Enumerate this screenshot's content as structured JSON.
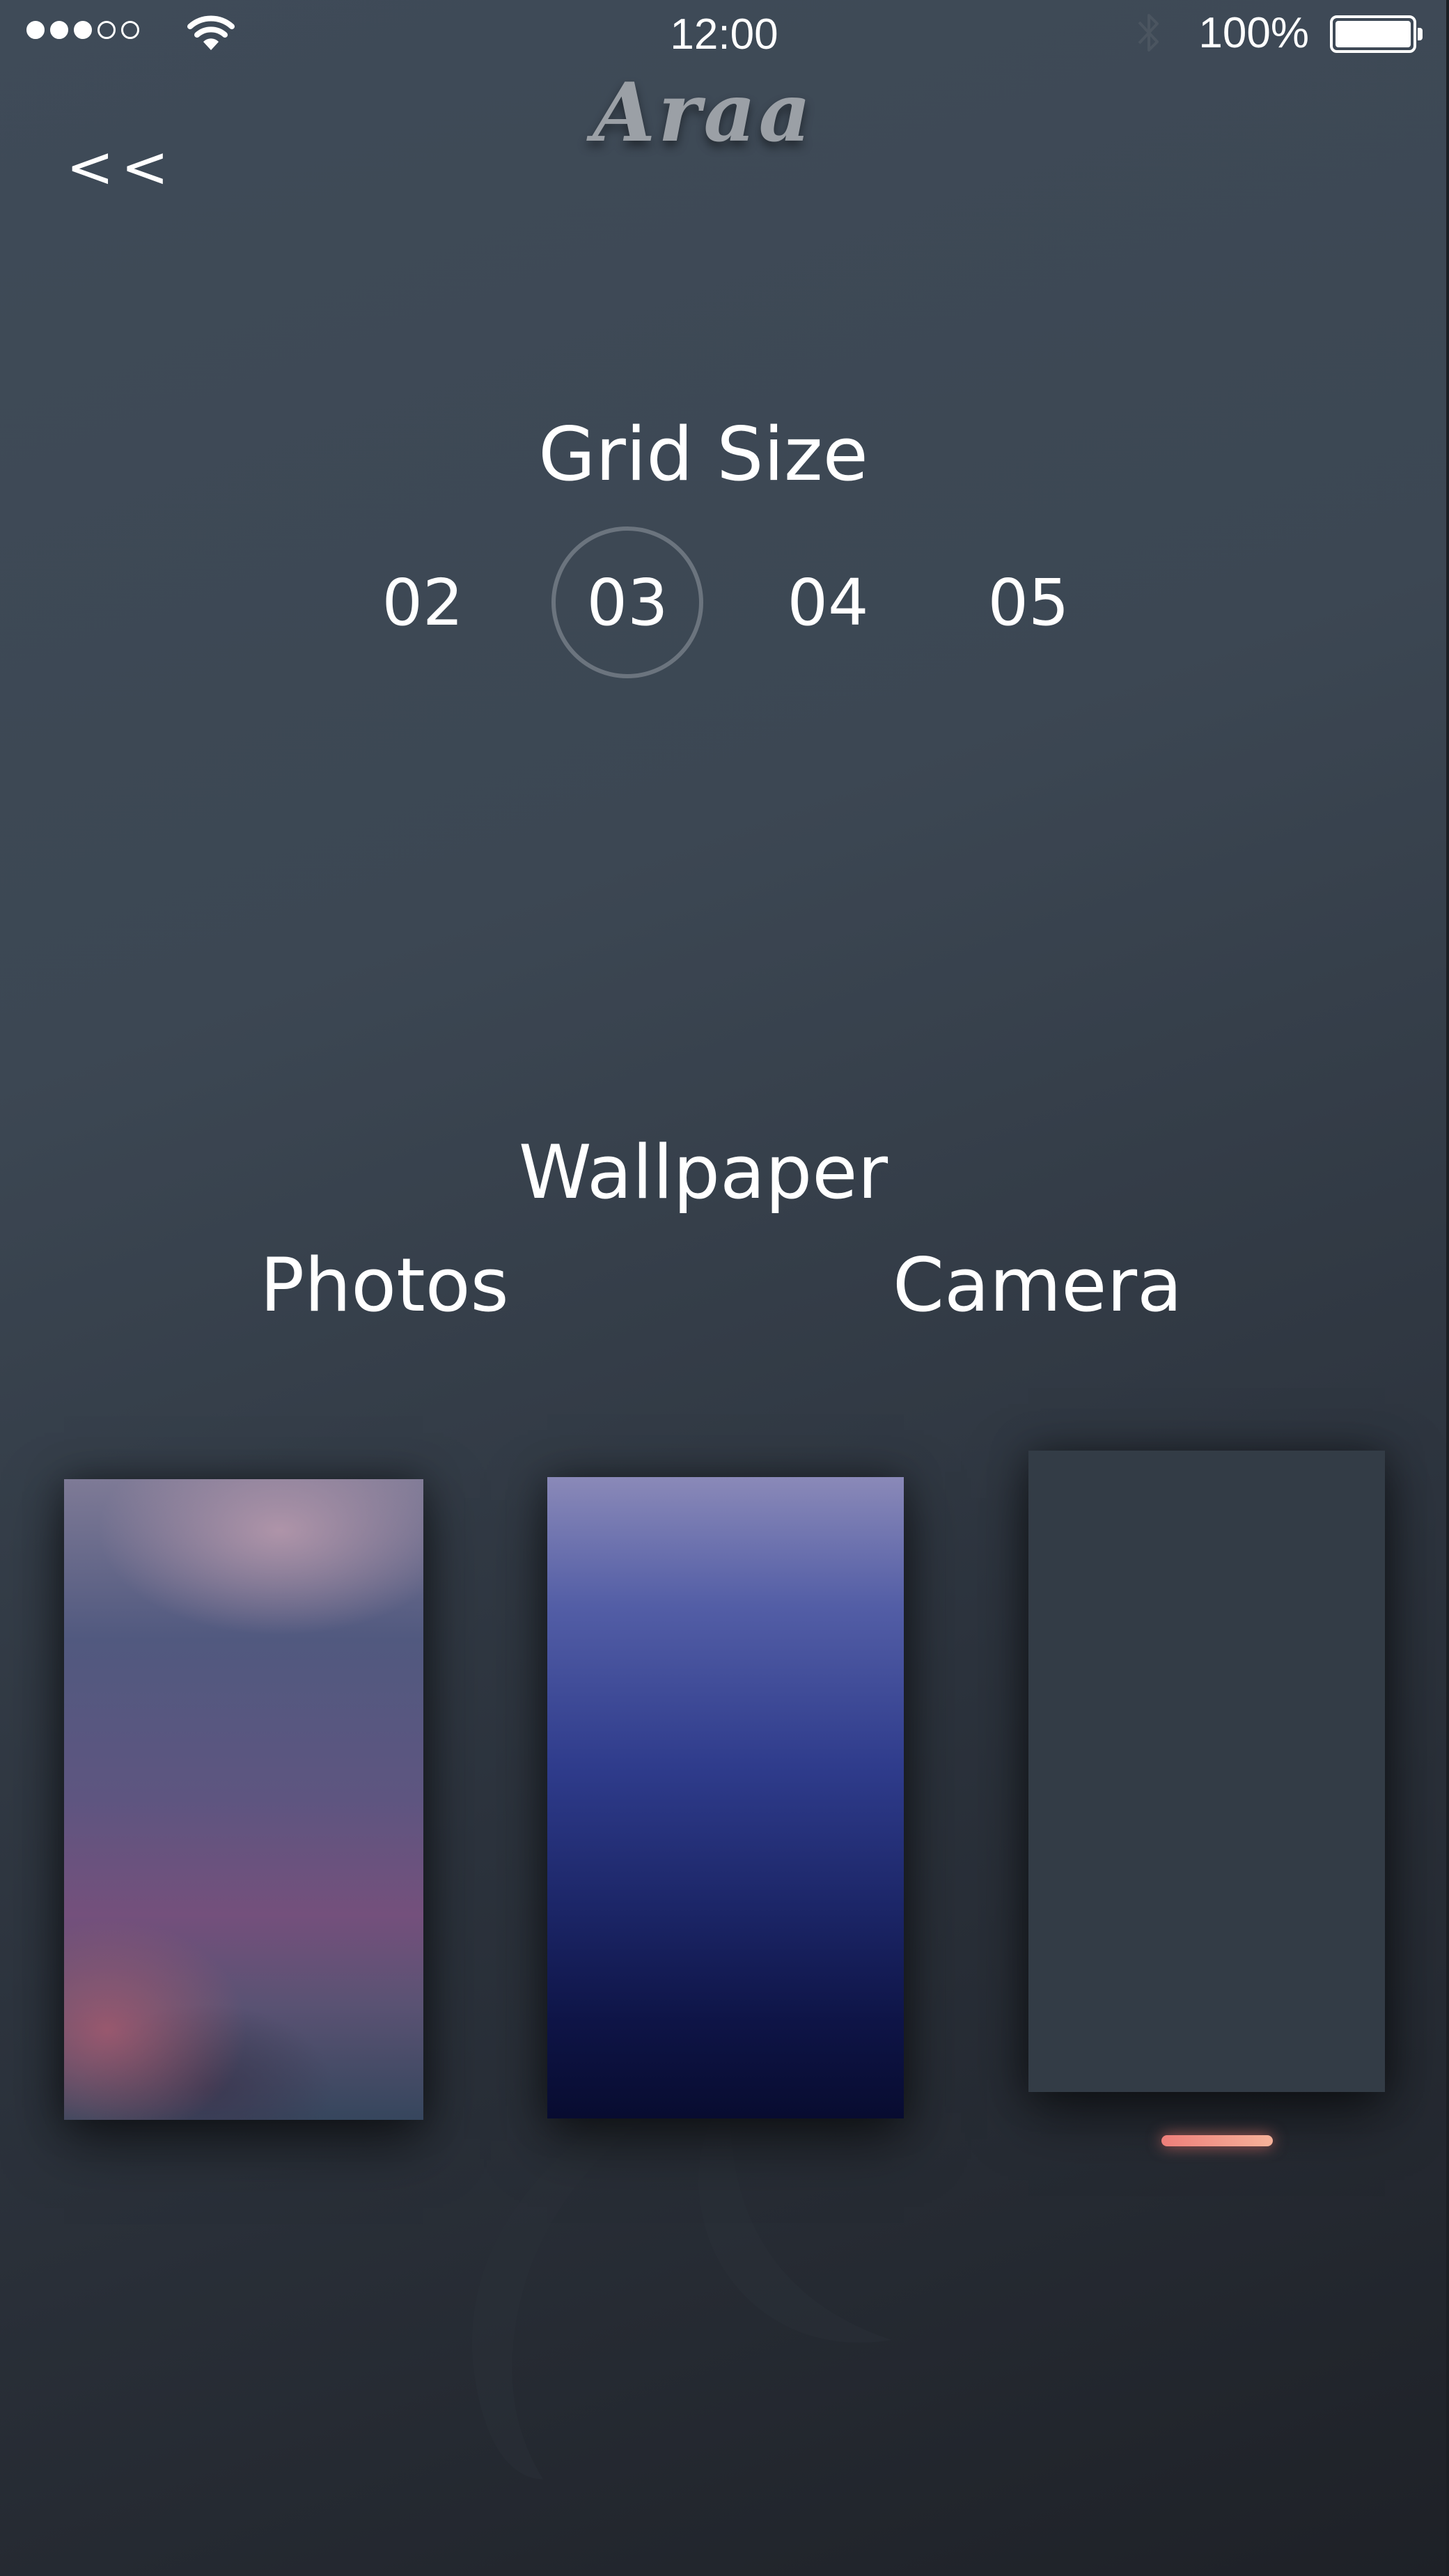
{
  "status_bar": {
    "signal_bars_filled": 3,
    "signal_bars_total": 5,
    "wifi_icon": "wifi-icon",
    "time": "12:00",
    "bluetooth_icon": "bluetooth-icon",
    "battery_percent": "100%",
    "battery_level": 1.0
  },
  "nav": {
    "back_label": "<<",
    "logo_text": "Araa"
  },
  "grid_size": {
    "title": "Grid Size",
    "options": [
      "02",
      "03",
      "04",
      "05"
    ],
    "selected": "03"
  },
  "wallpaper": {
    "title": "Wallpaper",
    "photos_label": "Photos",
    "camera_label": "Camera",
    "thumbnails": [
      {
        "name": "blurred-purple-pink",
        "selected": false
      },
      {
        "name": "blue-gradient",
        "selected": false
      },
      {
        "name": "dark-slate",
        "selected": true
      }
    ]
  },
  "colors": {
    "background_top": "#3f4b58",
    "background_bottom": "#1e2127",
    "selection_ring": "#6b747e",
    "active_indicator": "#ee7f7a"
  }
}
